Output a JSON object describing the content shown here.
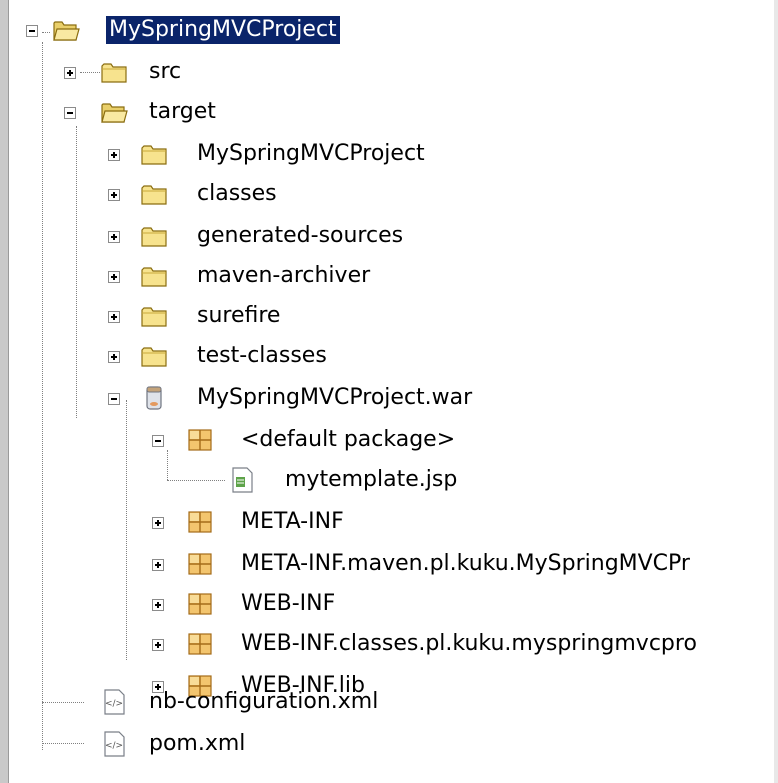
{
  "tree": {
    "root": {
      "label": "MySpringMVCProject",
      "selected": true,
      "icon": "project-folder-icon"
    },
    "src": {
      "label": "src",
      "icon": "folder-icon"
    },
    "target": {
      "label": "target",
      "icon": "folder-open-icon"
    },
    "target_children": [
      {
        "label": "MySpringMVCProject",
        "icon": "folder-icon"
      },
      {
        "label": "classes",
        "icon": "folder-icon"
      },
      {
        "label": "generated-sources",
        "icon": "folder-icon"
      },
      {
        "label": "maven-archiver",
        "icon": "folder-icon"
      },
      {
        "label": "surefire",
        "icon": "folder-icon"
      },
      {
        "label": "test-classes",
        "icon": "folder-icon"
      },
      {
        "label": "MySpringMVCProject.war",
        "icon": "war-archive-icon"
      }
    ],
    "war_children": [
      {
        "label": "<default package>",
        "icon": "package-icon"
      },
      {
        "label": "mytemplate.jsp",
        "icon": "jsp-file-icon"
      },
      {
        "label": "META-INF",
        "icon": "package-icon"
      },
      {
        "label": "META-INF.maven.pl.kuku.MySpringMVCPr",
        "icon": "package-icon"
      },
      {
        "label": "WEB-INF",
        "icon": "package-icon"
      },
      {
        "label": "WEB-INF.classes.pl.kuku.myspringmvcpro",
        "icon": "package-icon"
      },
      {
        "label": "WEB-INF.lib",
        "icon": "package-icon"
      }
    ],
    "root_files": [
      {
        "label": "nb-configuration.xml",
        "icon": "xml-file-icon"
      },
      {
        "label": "pom.xml",
        "icon": "xml-file-icon"
      }
    ]
  },
  "colors": {
    "selection": "#0a246a",
    "folder": "#f5e08a",
    "package": "#e8b860"
  }
}
